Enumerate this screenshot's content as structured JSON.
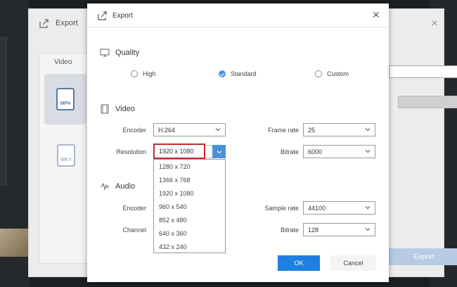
{
  "background_window": {
    "title": "Export",
    "sidebar_label": "Video",
    "formats": [
      "MP4",
      "MKV"
    ],
    "export_button": "Export"
  },
  "dialog": {
    "title": "Export",
    "close_icon": "close-icon",
    "quality": {
      "heading": "Quality",
      "options": [
        {
          "label": "High",
          "checked": false
        },
        {
          "label": "Standard",
          "checked": true
        },
        {
          "label": "Custom",
          "checked": false
        }
      ]
    },
    "video": {
      "heading": "Video",
      "encoder_label": "Encoder",
      "encoder_value": "H.264",
      "frame_rate_label": "Frame rate",
      "frame_rate_value": "25",
      "resolution_label": "Resolution",
      "resolution_value": "1920 x 1080",
      "bitrate_label": "Bitrate",
      "bitrate_value": "6000",
      "resolution_options": [
        "1280 x 720",
        "1366 x 768",
        "1920 x 1080",
        "960 x 540",
        "852 x 480",
        "640 x 360",
        "432 x 240"
      ]
    },
    "audio": {
      "heading": "Audio",
      "encoder_label": "Encoder",
      "sample_rate_label": "Sample rate",
      "sample_rate_value": "44100",
      "channel_label": "Channel",
      "bitrate_label": "Bitrate",
      "bitrate_value": "128"
    },
    "ok_label": "OK",
    "cancel_label": "Cancel"
  },
  "colors": {
    "accent": "#1f7fe0",
    "highlight_border": "#c62b2b"
  }
}
